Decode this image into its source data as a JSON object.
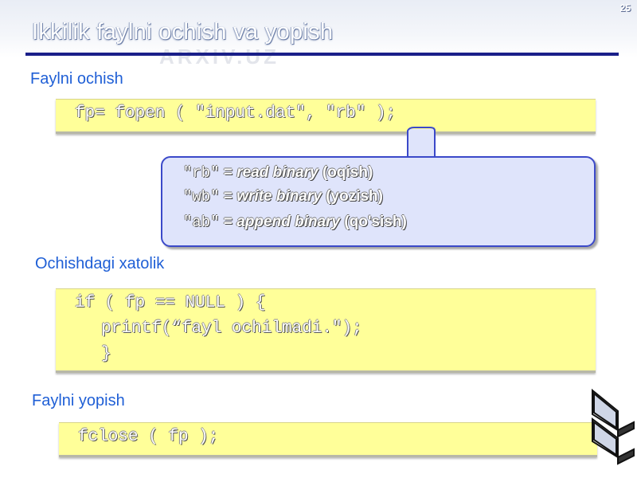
{
  "page_number": "25",
  "title": "Ikkilik faylni ochish va yopish",
  "watermark": "ARXIV.UZ",
  "sections": {
    "open": {
      "label": "Faylni ochish",
      "code": "fp= fopen ( \"input.dat\", \"rb\" );"
    },
    "modes": [
      {
        "code": "\"rb\"",
        "eq": " = ",
        "term": "read binary",
        "desc": " (oqish)"
      },
      {
        "code": "\"wb\"",
        "eq": " = ",
        "term": "write binary",
        "desc": " (yozish)"
      },
      {
        "code": "\"ab\"",
        "eq": " = ",
        "term": "append binary",
        "desc": " (qo'sish)"
      }
    ],
    "error": {
      "label": "Ochishdagi xatolik",
      "code_lines": [
        "if ( fp == NULL ) {",
        "  printf(“fayl ochilmadi.\");",
        "  }"
      ]
    },
    "close": {
      "label": "Faylni yopish",
      "code": "fclose ( fp );"
    }
  },
  "colors": {
    "heading_blue": "#1f5fd6",
    "rule": "#1a1f8a",
    "code_bg": "#ffff99",
    "callout_bg": "#dfe4fb",
    "callout_border": "#3b49c9"
  }
}
